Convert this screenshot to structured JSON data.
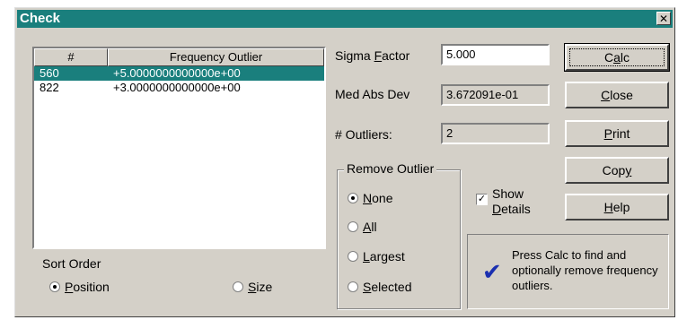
{
  "window": {
    "title": "Check",
    "close_glyph": "✕"
  },
  "table": {
    "headers": [
      "#",
      "Frequency Outlier"
    ],
    "rows": [
      {
        "num": "560",
        "value": "+5.0000000000000e+00",
        "selected": true
      },
      {
        "num": "822",
        "value": "+3.0000000000000e+00",
        "selected": false
      }
    ]
  },
  "sort_order": {
    "label": "Sort Order",
    "options": [
      {
        "first": "P",
        "rest": "osition",
        "checked": true
      },
      {
        "first": "S",
        "rest": "ize",
        "checked": false
      }
    ]
  },
  "fields": {
    "sigma_label_pre": "Sigma ",
    "sigma_label_key": "F",
    "sigma_label_post": "actor",
    "sigma_value": "5.000",
    "medabs_label": "Med Abs Dev",
    "medabs_value": "3.672091e-01",
    "outliers_label": "# Outliers:",
    "outliers_value": "2"
  },
  "remove_outlier": {
    "label": "Remove Outlier",
    "options": [
      {
        "first": "N",
        "rest": "one",
        "checked": true
      },
      {
        "first": "A",
        "rest": "ll",
        "checked": false
      },
      {
        "first": "L",
        "rest": "argest",
        "checked": false
      },
      {
        "first": "S",
        "rest": "elected",
        "checked": false
      }
    ]
  },
  "show_details": {
    "line1": "Show",
    "line2_key": "D",
    "line2_rest": "etails",
    "checked": true,
    "mark": "✓"
  },
  "buttons": {
    "calc": {
      "pre": "C",
      "key": "a",
      "post": "lc"
    },
    "close": {
      "pre": "",
      "key": "C",
      "post": "lose"
    },
    "print": {
      "pre": "",
      "key": "P",
      "post": "rint"
    },
    "copy": {
      "pre": "Cop",
      "key": "y",
      "post": ""
    },
    "help": {
      "pre": "",
      "key": "H",
      "post": "elp"
    }
  },
  "info": {
    "icon": "checkmark-icon",
    "glyph": "✔",
    "message": "Press Calc to find and optionally remove frequency outliers."
  }
}
